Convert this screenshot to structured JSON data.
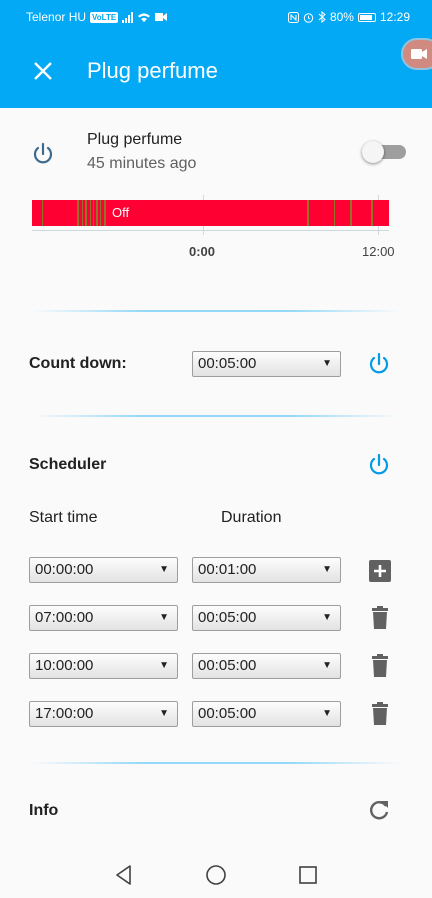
{
  "status_bar": {
    "carrier": "Telenor HU",
    "volte": "VoLTE",
    "battery": "80%",
    "time": "12:29",
    "icons": [
      "signal-icon",
      "wifi-icon",
      "video-icon",
      "nfc-icon",
      "alarm-icon",
      "bluetooth-icon",
      "battery-icon"
    ]
  },
  "header": {
    "title": "Plug perfume",
    "close_icon": "close-icon"
  },
  "device": {
    "name": "Plug perfume",
    "last_seen": "45 minutes ago",
    "toggle_on": false,
    "power_icon": "power-icon"
  },
  "timeline": {
    "state_label": "Off",
    "tick_labels": [
      "0:00",
      "12:00"
    ]
  },
  "countdown": {
    "label": "Count down:",
    "value": "00:05:00",
    "power_icon": "power-icon"
  },
  "scheduler": {
    "label": "Scheduler",
    "start_header": "Start time",
    "duration_header": "Duration",
    "rows": [
      {
        "start": "00:00:00",
        "duration": "00:01:00",
        "action": "add"
      },
      {
        "start": "07:00:00",
        "duration": "00:05:00",
        "action": "delete"
      },
      {
        "start": "10:00:00",
        "duration": "00:05:00",
        "action": "delete"
      },
      {
        "start": "17:00:00",
        "duration": "00:05:00",
        "action": "delete"
      }
    ]
  },
  "info": {
    "label": "Info",
    "refresh_icon": "refresh-icon"
  },
  "colors": {
    "primary": "#03a9f4",
    "accent": "#039be5",
    "timeline_off": "#ff0033"
  }
}
